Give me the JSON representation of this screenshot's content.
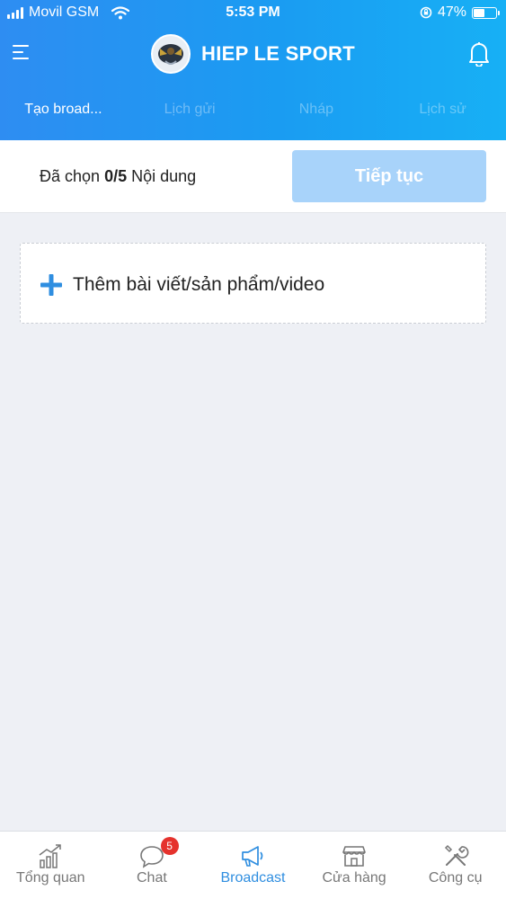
{
  "status_bar": {
    "carrier": "Movil GSM",
    "time": "5:53 PM",
    "battery": "47%",
    "battery_level": 0.47,
    "icons": [
      "signal-icon",
      "wifi-icon",
      "rotation-lock-icon",
      "battery-icon"
    ]
  },
  "header": {
    "title": "HIEP LE SPORT",
    "icons": [
      "menu-icon",
      "avatar",
      "bell-icon"
    ]
  },
  "tabs": [
    {
      "label": "Tạo broad...",
      "active": true
    },
    {
      "label": "Lịch gửi",
      "active": false
    },
    {
      "label": "Nháp",
      "active": false
    },
    {
      "label": "Lịch sử",
      "active": false
    }
  ],
  "selection": {
    "prefix": "Đã chọn",
    "count": "0/5",
    "suffix": "Nội dung",
    "continue_label": "Tiếp tục"
  },
  "add_content": {
    "label": "Thêm bài viết/sản phẩm/video",
    "icon": "plus-icon"
  },
  "bottom_nav": [
    {
      "label": "Tổng quan",
      "icon": "chart-icon"
    },
    {
      "label": "Chat",
      "icon": "chat-bubble-icon",
      "badge": "5"
    },
    {
      "label": "Broadcast",
      "icon": "megaphone-icon",
      "active": true
    },
    {
      "label": "Cửa hàng",
      "icon": "store-icon"
    },
    {
      "label": "Công cụ",
      "icon": "tools-icon"
    }
  ],
  "colors": {
    "header_start": "#2e8df2",
    "header_end": "#17b0f5",
    "accent": "#2f8ee0",
    "button_disabled": "#a8d3fa",
    "badge": "#e5322d"
  }
}
